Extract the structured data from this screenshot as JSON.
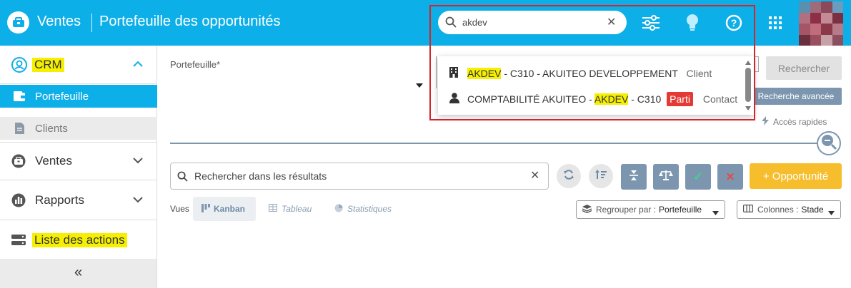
{
  "header": {
    "app_title": "Ventes",
    "page_title": "Portefeuille des opportunités",
    "search_value": "akdev",
    "colors": {
      "bar": "#0dafe8"
    },
    "icons": [
      "search-icon",
      "filter-sliders-icon",
      "lightbulb-icon",
      "help-icon",
      "apps-grid-icon"
    ]
  },
  "sidebar": {
    "crm": "CRM",
    "portefeuille": "Portefeuille",
    "clients": "Clients",
    "ventes": "Ventes",
    "rapports": "Rapports",
    "liste_actions": "Liste des actions",
    "collapse": "«"
  },
  "search_dropdown": {
    "rows": [
      {
        "hl": "AKDEV",
        "rest": " - C310 - AKUITEO DEVELOPPEMENT",
        "type": "Client"
      },
      {
        "pre": "COMPTABILITÉ AKUITEO - ",
        "hl": "AKDEV",
        "rest": " - C310",
        "badge": "Parti",
        "type": "Contact"
      }
    ]
  },
  "filters": {
    "portefeuille_label": "Portefeuille*",
    "rechercher": "Rechercher",
    "recherche_avancee": "Recherche avancée",
    "acces_rapides": "Accès rapides"
  },
  "results": {
    "search_placeholder": "Rechercher dans les résultats",
    "add_button": "+ Opportunité",
    "vues_label": "Vues",
    "kanban": "Kanban",
    "tableau": "Tableau",
    "statistiques": "Statistiques",
    "group_label": "Regrouper par :",
    "group_value": "Portefeuille",
    "columns_label": "Colonnes :",
    "columns_value": "Stade"
  }
}
